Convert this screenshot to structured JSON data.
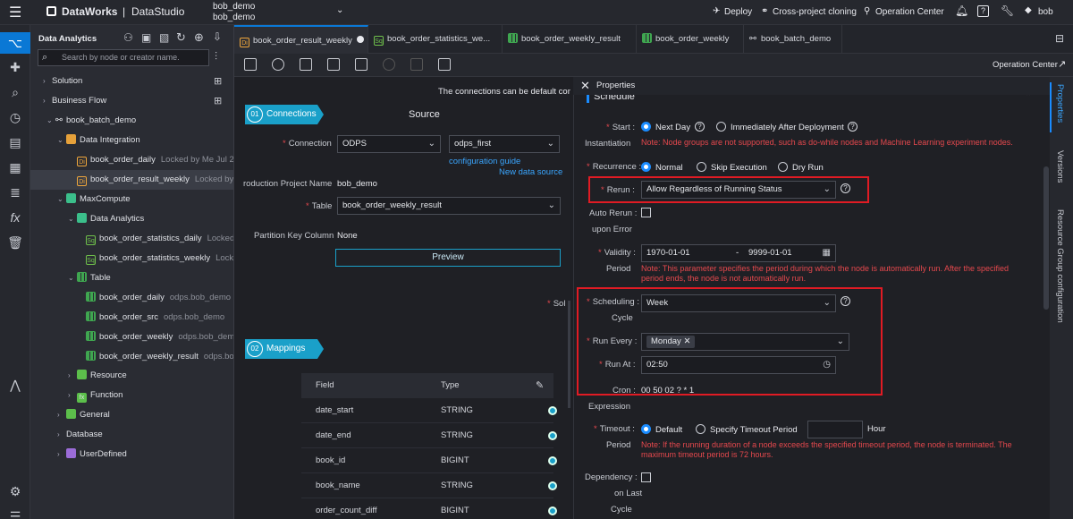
{
  "header": {
    "brand": "DataWorks",
    "product": "DataStudio",
    "workspace_line1": "bob_demo",
    "workspace_line2": "bob_demo",
    "deploy": "Deploy",
    "cross_project": "Cross-project cloning",
    "operation_center": "Operation Center",
    "user": "bob"
  },
  "sidebar": {
    "title": "Data Analytics",
    "search_placeholder": "Search by node or creator name.",
    "solution": "Solution",
    "business_flow": "Business Flow",
    "flow": "book_batch_demo",
    "data_integration": "Data Integration",
    "di_item1": "book_order_daily",
    "di_item1_meta": "Locked by Me   Jul 29",
    "di_item2": "book_order_result_weekly",
    "di_item2_meta": "Locked by M",
    "maxcompute": "MaxCompute",
    "data_analytics": "Data Analytics",
    "da_item1": "book_order_statistics_daily",
    "da_item1_meta": "Locked",
    "da_item2": "book_order_statistics_weekly",
    "da_item2_meta": "Locke",
    "table": "Table",
    "t1": "book_order_daily",
    "t1_meta": "odps.bob_demo",
    "t2": "book_order_src",
    "t2_meta": "odps.bob_demo",
    "t3": "book_order_weekly",
    "t3_meta": "odps.bob_demo",
    "t4": "book_order_weekly_result",
    "t4_meta": "odps.bob",
    "resource": "Resource",
    "function": "Function",
    "general": "General",
    "database": "Database",
    "userdefined": "UserDefined"
  },
  "tabs": [
    {
      "label": "book_order_result_weekly"
    },
    {
      "label": "book_order_statistics_we..."
    },
    {
      "label": "book_order_weekly_result"
    },
    {
      "label": "book_order_weekly"
    },
    {
      "label": "book_batch_demo"
    }
  ],
  "toolbar": {
    "operation_center": "Operation Center"
  },
  "editor": {
    "notice": "The connections can be default con",
    "connections_badge": "Connections",
    "source_title": "Source",
    "connection_label": "Connection",
    "connection_type": "ODPS",
    "connection_name": "odps_first",
    "config_guide": "configuration guide",
    "new_source": "New data source",
    "project_label": "roduction Project Name",
    "project_value": "bob_demo",
    "table_label": "Table",
    "table_value": "book_order_weekly_result",
    "partition_label": "Partition Key Column",
    "partition_value": "None",
    "preview": "Preview",
    "sol_fragment": "Sol",
    "mappings_badge": "Mappings",
    "field_header": "Field",
    "type_header": "Type",
    "fields": [
      {
        "name": "date_start",
        "type": "STRING"
      },
      {
        "name": "date_end",
        "type": "STRING"
      },
      {
        "name": "book_id",
        "type": "BIGINT"
      },
      {
        "name": "book_name",
        "type": "STRING"
      },
      {
        "name": "order_count_diff",
        "type": "BIGINT"
      }
    ]
  },
  "properties": {
    "title": "Properties",
    "section": "Schedule",
    "start_label": "Start :",
    "start_opt1": "Next Day",
    "start_opt2": "Immediately After Deployment",
    "instantiation": "Instantiation",
    "start_note": "Note: Node groups are not supported, such as do-while nodes and Machine Learning experiment nodes.",
    "recurrence_label": "Recurrence :",
    "rec_opt1": "Normal",
    "rec_opt2": "Skip Execution",
    "rec_opt3": "Dry Run",
    "rerun_label": "Rerun :",
    "rerun_value": "Allow Regardless of Running Status",
    "auto_rerun1": "Auto Rerun :",
    "auto_rerun2": "upon Error",
    "validity_label": "Validity :",
    "validity_label2": "Period",
    "valid_from": "1970-01-01",
    "valid_sep": "-",
    "valid_to": "9999-01-01",
    "validity_note": "Note: This parameter specifies the period during which the node is automatically run. After the specified period ends, the node is not automatically run.",
    "scheduling_label": "Scheduling :",
    "scheduling_label2": "Cycle",
    "scheduling_value": "Week",
    "run_every_label": "Run Every :",
    "run_every_value": "Monday",
    "run_at_label": "Run At :",
    "run_at_value": "02:50",
    "cron_label": "Cron :",
    "cron_label2": "Expression",
    "cron_value": "00 50 02 ? * 1",
    "timeout_label": "Timeout :",
    "timeout_label2": "Period",
    "timeout_opt1": "Default",
    "timeout_opt2": "Specify Timeout Period",
    "timeout_unit": "Hour",
    "timeout_note": "Note: If the running duration of a node exceeds the specified timeout period, the node is terminated. The maximum timeout period is 72 hours.",
    "dependency1": "Dependency :",
    "dependency2": "on Last",
    "dependency3": "Cycle"
  },
  "right_tabs": {
    "props": "Properties",
    "versions": "Versions",
    "resource": "Resource Group configuration"
  },
  "colors": {
    "accent": "#0a78d5",
    "badge": "#1aa0c9",
    "error": "#e5484d",
    "highlight": "#e01b24"
  }
}
